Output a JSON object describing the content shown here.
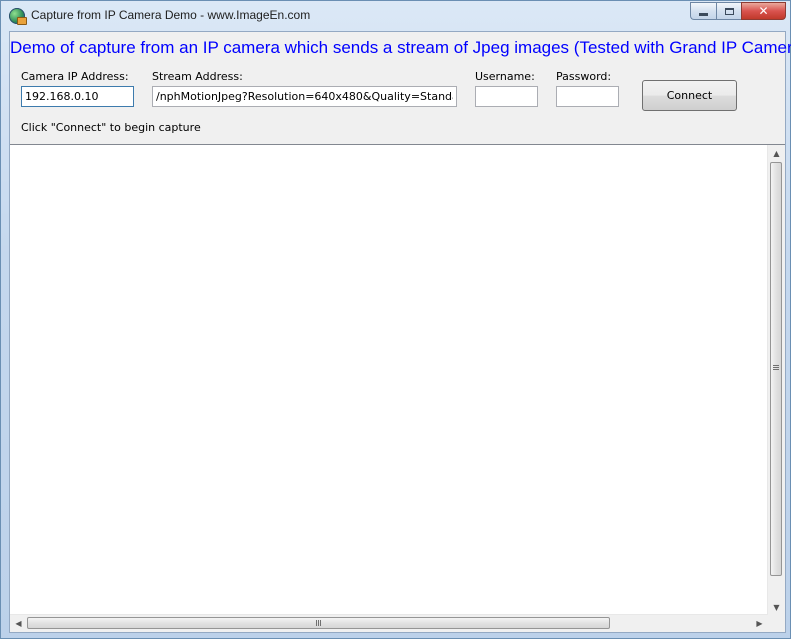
{
  "window": {
    "title": "Capture from IP Camera Demo - www.ImageEn.com",
    "minimize_glyph": "",
    "close_glyph": "✕"
  },
  "header": {
    "headline": "Demo of capture from an IP camera which sends a stream of Jpeg images (Tested with Grand IP Camera III)"
  },
  "form": {
    "camera_ip_label": "Camera IP Address:",
    "camera_ip_value": "192.168.0.10",
    "stream_label": "Stream Address:",
    "stream_value": "/nphMotionJpeg?Resolution=640x480&Quality=Standard",
    "username_label": "Username:",
    "username_value": "",
    "password_label": "Password:",
    "password_value": "",
    "connect_label": "Connect"
  },
  "status": {
    "text": "Click \"Connect\" to begin capture"
  },
  "scrollbars": {
    "up_glyph": "▲",
    "down_glyph": "▼",
    "left_glyph": "◀",
    "right_glyph": "▶"
  },
  "colors": {
    "headline": "#0000ff",
    "close_button": "#c0392b"
  },
  "icons": [
    "app-globe-icon",
    "minimize-icon",
    "maximize-icon",
    "close-icon",
    "scroll-up-icon",
    "scroll-down-icon",
    "scroll-left-icon",
    "scroll-right-icon"
  ]
}
